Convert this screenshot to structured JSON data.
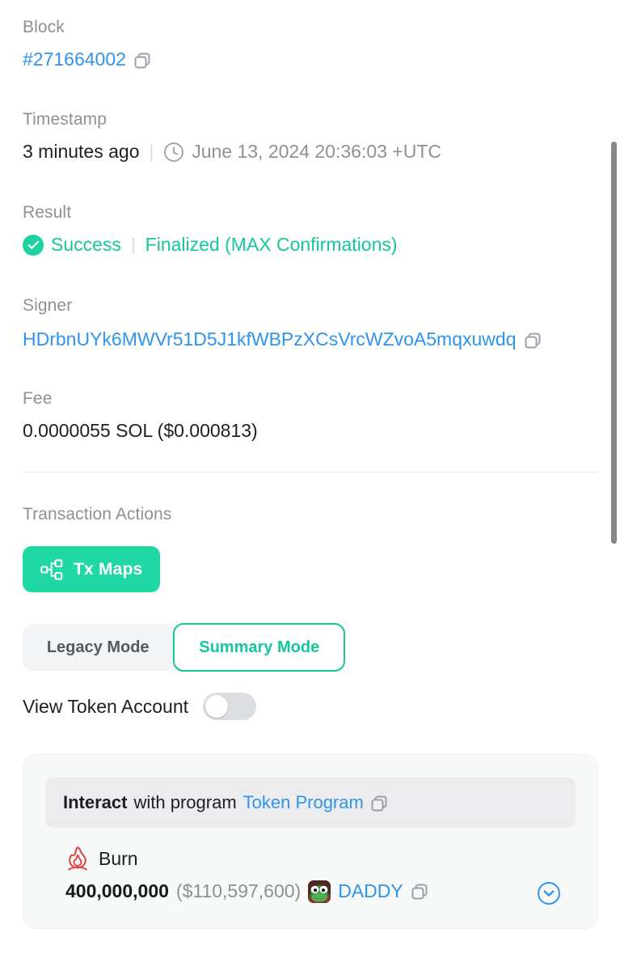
{
  "accent": {
    "green": "#1fd1a0",
    "link_blue": "#2f94ed",
    "burn_red": "#e2403f",
    "gray_label": "#8c9196"
  },
  "fields": {
    "block": {
      "label": "Block",
      "value": "#271664002",
      "copy_icon": "copy-icon"
    },
    "timestamp": {
      "label": "Timestamp",
      "relative": "3 minutes ago",
      "separator": "|",
      "clock_icon": "clock-icon",
      "absolute": "June 13, 2024 20:36:03 +UTC"
    },
    "result": {
      "label": "Result",
      "status_icon": "check-circle-icon",
      "status": "Success",
      "separator": "|",
      "confirmation": "Finalized (MAX Confirmations)"
    },
    "signer": {
      "label": "Signer",
      "value": "HDrbnUYk6MWVr51D5J1kfWBPzXCsVrcWZvoA5mqxuwdq",
      "copy_icon": "copy-icon"
    },
    "fee": {
      "label": "Fee",
      "value": "0.0000055 SOL ($0.000813)"
    }
  },
  "transaction_actions": {
    "label": "Transaction Actions",
    "tx_maps_button": {
      "label": "Tx Maps",
      "icon": "sitemap-icon"
    },
    "mode_switch": {
      "legacy_label": "Legacy Mode",
      "summary_label": "Summary Mode",
      "selected": "Summary Mode"
    },
    "token_account_toggle": {
      "label": "View Token Account",
      "state": "off"
    }
  },
  "instruction_card": {
    "header": {
      "action_word": "Interact",
      "middle_text": "with program",
      "program_name": "Token Program",
      "copy_icon": "copy-icon"
    },
    "action": {
      "icon": "fire-icon",
      "name": "Burn",
      "amount": "400,000,000",
      "usd_value": "($110,597,600)",
      "token_avatar": "pepe-token-avatar",
      "token_symbol": "DADDY",
      "copy_icon": "copy-icon",
      "expand_icon": "chevron-down-circle-icon"
    }
  },
  "scrollbar": {
    "name": "vertical-scrollbar"
  }
}
